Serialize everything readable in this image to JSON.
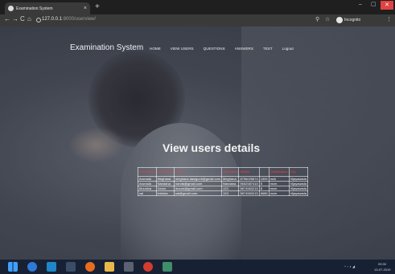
{
  "browser": {
    "tab_title": "Examination System",
    "tab_close": "×",
    "new_tab": "+",
    "url_host": "127.0.0.1",
    "url_path": ":8000/userview/",
    "incognito_label": "Incognito",
    "window_minimize": "–",
    "window_maximize": "▢",
    "window_close": "✕",
    "nav_back": "←",
    "nav_forward": "→",
    "nav_reload": "C",
    "nav_home": "⌂",
    "search_icon_glyph": "⚲",
    "star_icon_glyph": "☆",
    "menu_icon_glyph": "⋮"
  },
  "site": {
    "brand": "Examination System",
    "nav": [
      "HOME",
      "VIEW USERS",
      "QUESTIONS",
      "ANSWERS",
      "TEST",
      "Logout"
    ]
  },
  "page": {
    "heading": "View users details"
  },
  "table": {
    "headers": [
      "First Name",
      "Last Name",
      "Email",
      "Username",
      "Mobile",
      "Qualification",
      "City"
    ],
    "rows": [
      [
        "Arumala",
        "Meghana",
        "meghana.dasigunti@gmail.com",
        "Meghana",
        "8796025874",
        "1505",
        "mch",
        "Vijayawada"
      ],
      [
        "Arumala",
        "Nandana",
        "nanda@gmail.com",
        "Nandana",
        "9652587415",
        "5",
        "mcm",
        "Vijayawada"
      ],
      [
        "Mounica",
        "Xxxxx",
        "mounr@gmail.com",
        "123",
        "9874563215",
        "8",
        "mcm",
        "Vijayawada"
      ],
      [
        "sai",
        "krishna",
        "sai@gmail.com",
        "123",
        "9874563215",
        "6685",
        "mcm",
        "Vijayawada"
      ]
    ]
  },
  "taskbar": {
    "time": "09:30",
    "date": "13-07-2019",
    "tray": "^ ◌ ◐ ◢"
  },
  "colors": {
    "header_text": "#ff3a3a",
    "taskbar_bg": "#172133",
    "close_button": "#e04343"
  }
}
